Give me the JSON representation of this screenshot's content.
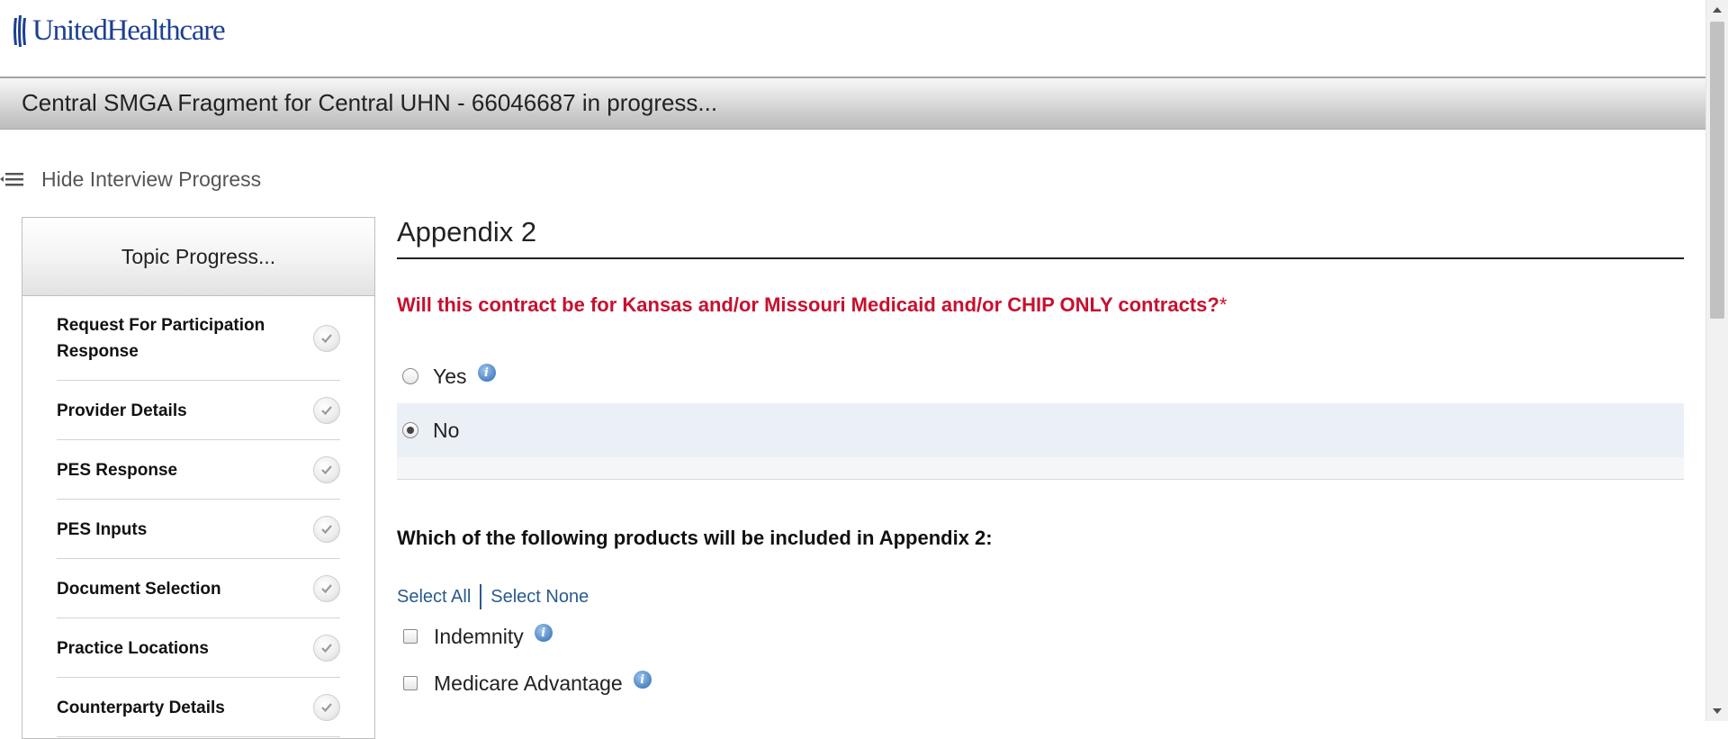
{
  "brand": {
    "logo_text": "UnitedHealthcare",
    "color": "#1c3f94"
  },
  "header": {
    "title": "Central SMGA Fragment for Central UHN - 66046687 in progress..."
  },
  "progress_toggle": {
    "label": "Hide Interview Progress",
    "icon": "collapse-list-icon"
  },
  "sidebar": {
    "title": "Topic Progress...",
    "items": [
      {
        "label": "Request For Participation Response",
        "status": "complete"
      },
      {
        "label": "Provider Details",
        "status": "complete"
      },
      {
        "label": "PES Response",
        "status": "complete"
      },
      {
        "label": "PES Inputs",
        "status": "complete"
      },
      {
        "label": "Document Selection",
        "status": "complete"
      },
      {
        "label": "Practice Locations",
        "status": "complete"
      },
      {
        "label": "Counterparty Details",
        "status": "complete"
      }
    ]
  },
  "main": {
    "title": "Appendix 2",
    "question1": {
      "text": "Will this contract be for Kansas and/or Missouri Medicaid and/or CHIP ONLY contracts?",
      "required_mark": "*",
      "color": "#c8102e",
      "options": [
        {
          "label": "Yes",
          "selected": false,
          "has_info": true
        },
        {
          "label": "No",
          "selected": true,
          "has_info": false
        }
      ]
    },
    "question2": {
      "text": "Which of the following products will be included in Appendix 2:",
      "select_all": "Select All",
      "select_none": "Select None",
      "options": [
        {
          "label": "Indemnity",
          "checked": false,
          "has_info": true
        },
        {
          "label": "Medicare Advantage",
          "checked": false,
          "has_info": true
        }
      ]
    }
  },
  "colors": {
    "link": "#2a5a8c",
    "selected_row_bg": "#ebf0f6",
    "info_icon": "#4d84c4"
  }
}
